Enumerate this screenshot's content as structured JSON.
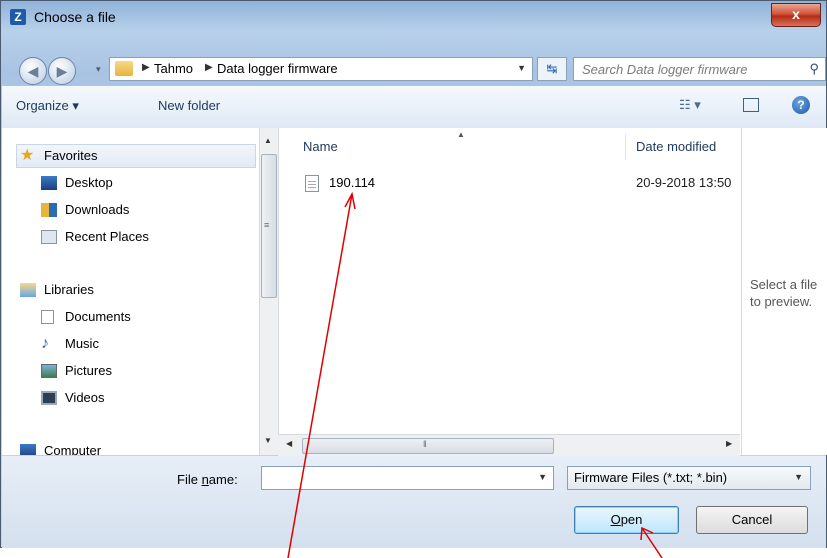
{
  "window": {
    "title": "Choose a file",
    "app_icon": "Z",
    "close_label": "x"
  },
  "address_bar": {
    "breadcrumbs": [
      "Tahmo",
      "Data logger firmware"
    ],
    "search_placeholder": "Search Data logger firmware"
  },
  "toolbar": {
    "organize_label": "Organize ▾",
    "new_folder_label": "New folder",
    "views_label": "☷ ▾",
    "help_label": "?"
  },
  "nav_pane": {
    "favorites_label": "Favorites",
    "favorites": [
      "Desktop",
      "Downloads",
      "Recent Places"
    ],
    "libraries_label": "Libraries",
    "libraries": [
      "Documents",
      "Music",
      "Pictures",
      "Videos"
    ],
    "computer_label": "Computer"
  },
  "file_list": {
    "columns": {
      "name": "Name",
      "date": "Date modified"
    },
    "files": [
      {
        "name": "190.114",
        "date_modified": "20-9-2018 13:50"
      }
    ]
  },
  "preview_pane": {
    "text": "Select a file to preview."
  },
  "footer": {
    "file_name_label_pre": "File ",
    "file_name_label_u": "n",
    "file_name_label_post": "ame:",
    "file_name_value": "",
    "filter_label": "Firmware Files (*.txt; *.bin)",
    "open_label_u": "O",
    "open_label_rest": "pen",
    "cancel_label": "Cancel"
  },
  "colors": {
    "annotation": "#e00000",
    "accent": "#1e5aa8"
  },
  "icons": {
    "back": "back-arrow-icon",
    "forward": "forward-arrow-icon",
    "refresh": "refresh-icon",
    "search": "search-icon",
    "help": "help-icon",
    "preview": "preview-pane-icon",
    "views": "views-icon",
    "file": "text-file-icon"
  }
}
